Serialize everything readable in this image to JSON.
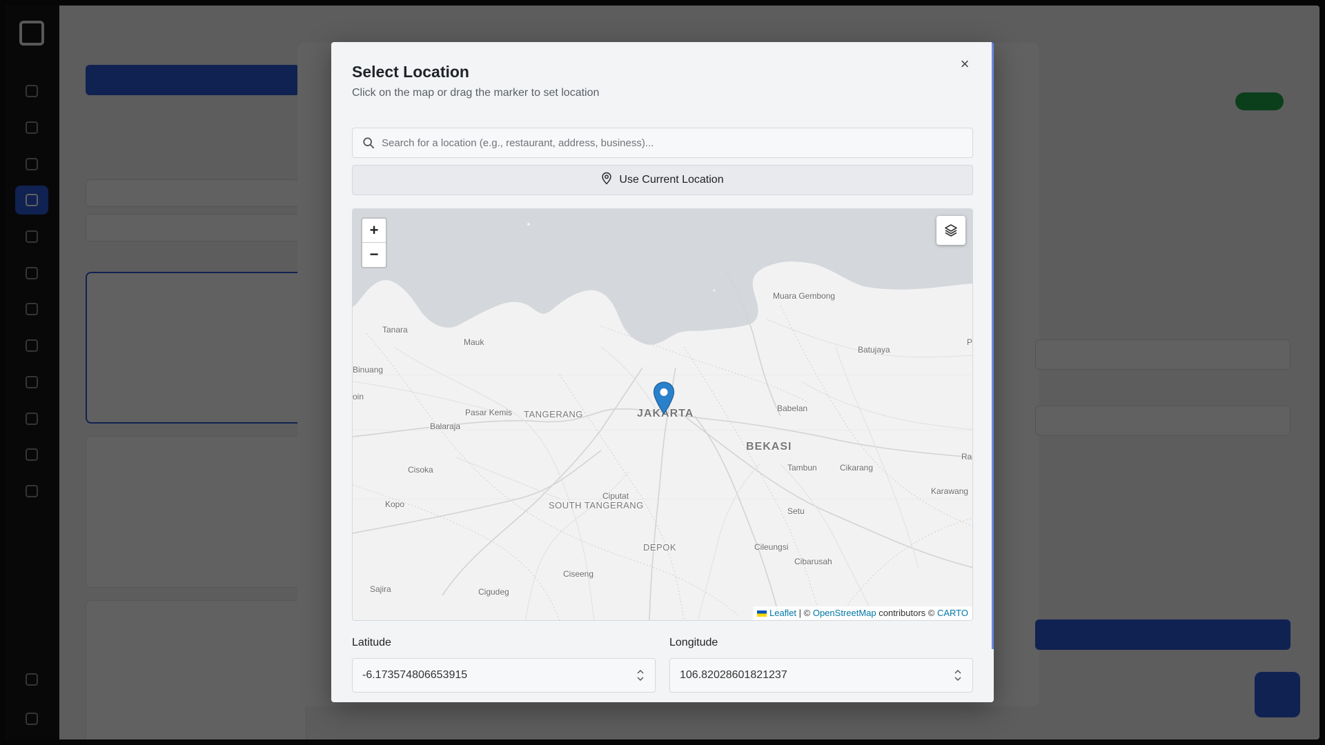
{
  "modal": {
    "title": "Select Location",
    "subtitle": "Click on the map or drag the marker to set location",
    "close_label": "×"
  },
  "search": {
    "placeholder": "Search for a location (e.g., restaurant, address, business)...",
    "value": ""
  },
  "use_current": {
    "label": "Use Current Location"
  },
  "map": {
    "zoom_in": "+",
    "zoom_out": "−",
    "layers_icon": "layers-icon",
    "marker_icon": "map-pin-icon",
    "places": [
      "Muara Gembong",
      "Tanara",
      "Mauk",
      "Batujaya",
      "P",
      "Binuang",
      "oin",
      "Pasar Kemis",
      "TANGERANG",
      "JAKARTA",
      "Babelan",
      "Balaraja",
      "BEKASI",
      "Cisoka",
      "Tambun",
      "Cikarang",
      "Ra",
      "Ciputat",
      "Karawang",
      "Kopo",
      "SOUTH TANGERANG",
      "Setu",
      "DEPOK",
      "Cileungsi",
      "Cibarusah",
      "Ciseeng",
      "Sajira",
      "Cigudeg"
    ],
    "attribution": {
      "leaflet": "Leaflet",
      "sep": " | © ",
      "osm": "OpenStreetMap",
      "contributors": " contributors © ",
      "carto": "CARTO"
    }
  },
  "latitude": {
    "label": "Latitude",
    "value": "-6.173574806653915"
  },
  "longitude": {
    "label": "Longitude",
    "value": "106.82028601821237"
  },
  "colors": {
    "accent": "#2b5bd6",
    "marker": "#2a81cb",
    "water": "#d4d8dc",
    "land": "#f2f2f2"
  }
}
